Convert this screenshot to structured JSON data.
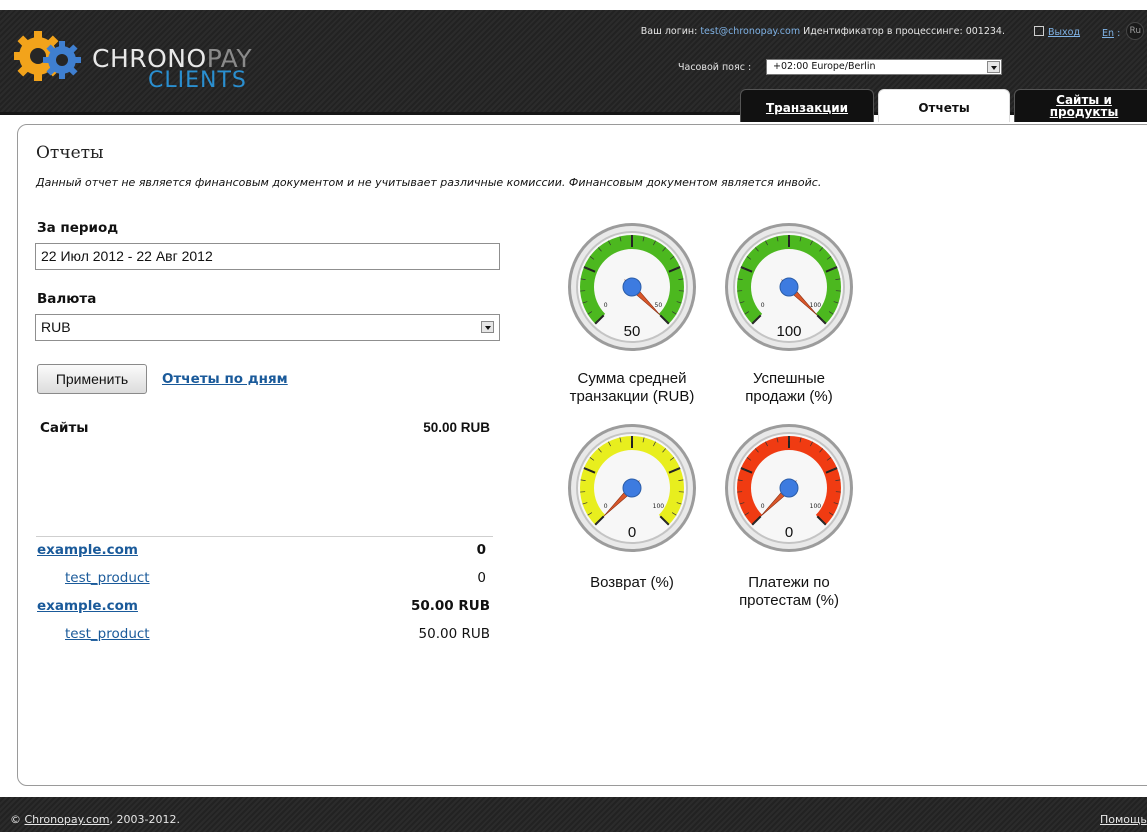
{
  "header": {
    "logo": {
      "line1_a": "CHRONO",
      "line1_b": "PAY",
      "line2": "CLIENTS"
    },
    "login_label": "Ваш логин:",
    "login_email": "test@chronopay.com",
    "processing_id_label": "Идентификатор в процессинге:",
    "processing_id": "001234.",
    "exit_label": "Выход",
    "lang_en": "En",
    "lang_sep": ":",
    "lang_ru": "Ru",
    "timezone_label": "Часовой пояс :",
    "timezone_value": "+02:00 Europe/Berlin",
    "tabs": [
      {
        "label": "Транзакции",
        "active": false
      },
      {
        "label": "Отчеты",
        "active": true
      },
      {
        "label": "Сайты и продукты",
        "label_line1": "Сайты и",
        "label_line2": "продукты",
        "active": false
      }
    ]
  },
  "main": {
    "title": "Отчеты",
    "disclaimer": "Данный отчет не является финансовым документом и не учитывает различные комиссии. Финансовым документом является инвойс.",
    "period_label": "За период",
    "period_value": "22 Июл 2012 - 22 Авг 2012",
    "currency_label": "Валюта",
    "currency_value": "RUB",
    "apply_button": "Применить",
    "daily_reports_link": "Отчеты по дням",
    "sites_header": "Сайты",
    "sites_total": "50.00 RUB",
    "rows": [
      {
        "name": "example.com",
        "value": "0",
        "type": "site"
      },
      {
        "name": "test_product",
        "value": "0",
        "type": "product"
      },
      {
        "name": "example.com",
        "value": "50.00 RUB",
        "type": "site"
      },
      {
        "name": "test_product",
        "value": "50.00 RUB",
        "type": "product"
      }
    ]
  },
  "gauges": [
    {
      "caption_1": "Сумма средней",
      "caption_2": "транзакции (RUB)",
      "value": 50,
      "value_label": "50",
      "min_label": "0",
      "max_label": "50",
      "max": 50,
      "color": "#4cb81f"
    },
    {
      "caption_1": "Успешные",
      "caption_2": "продажи (%)",
      "value": 100,
      "value_label": "100",
      "min_label": "0",
      "max_label": "100",
      "max": 100,
      "color": "#4cb81f"
    },
    {
      "caption_1": "Возврат (%)",
      "caption_2": "",
      "value": 0,
      "value_label": "0",
      "min_label": "0",
      "max_label": "100",
      "max": 100,
      "color": "#e8ee1e"
    },
    {
      "caption_1": "Платежи по",
      "caption_2": "протестам (%)",
      "value": 0,
      "value_label": "0",
      "min_label": "0",
      "max_label": "100",
      "max": 100,
      "color": "#f03b12"
    }
  ],
  "footer": {
    "copyright_symbol": "©",
    "copyright_link": "Chronopay.com",
    "copyright_years": ", 2003-2012.",
    "help_link": "Помощь"
  },
  "colors": {
    "link": "#1a5a9a",
    "header_bg": "#262626",
    "logo_blue": "#2a8fd0",
    "needle": "#d9572a",
    "hub": "#3d7be0"
  }
}
